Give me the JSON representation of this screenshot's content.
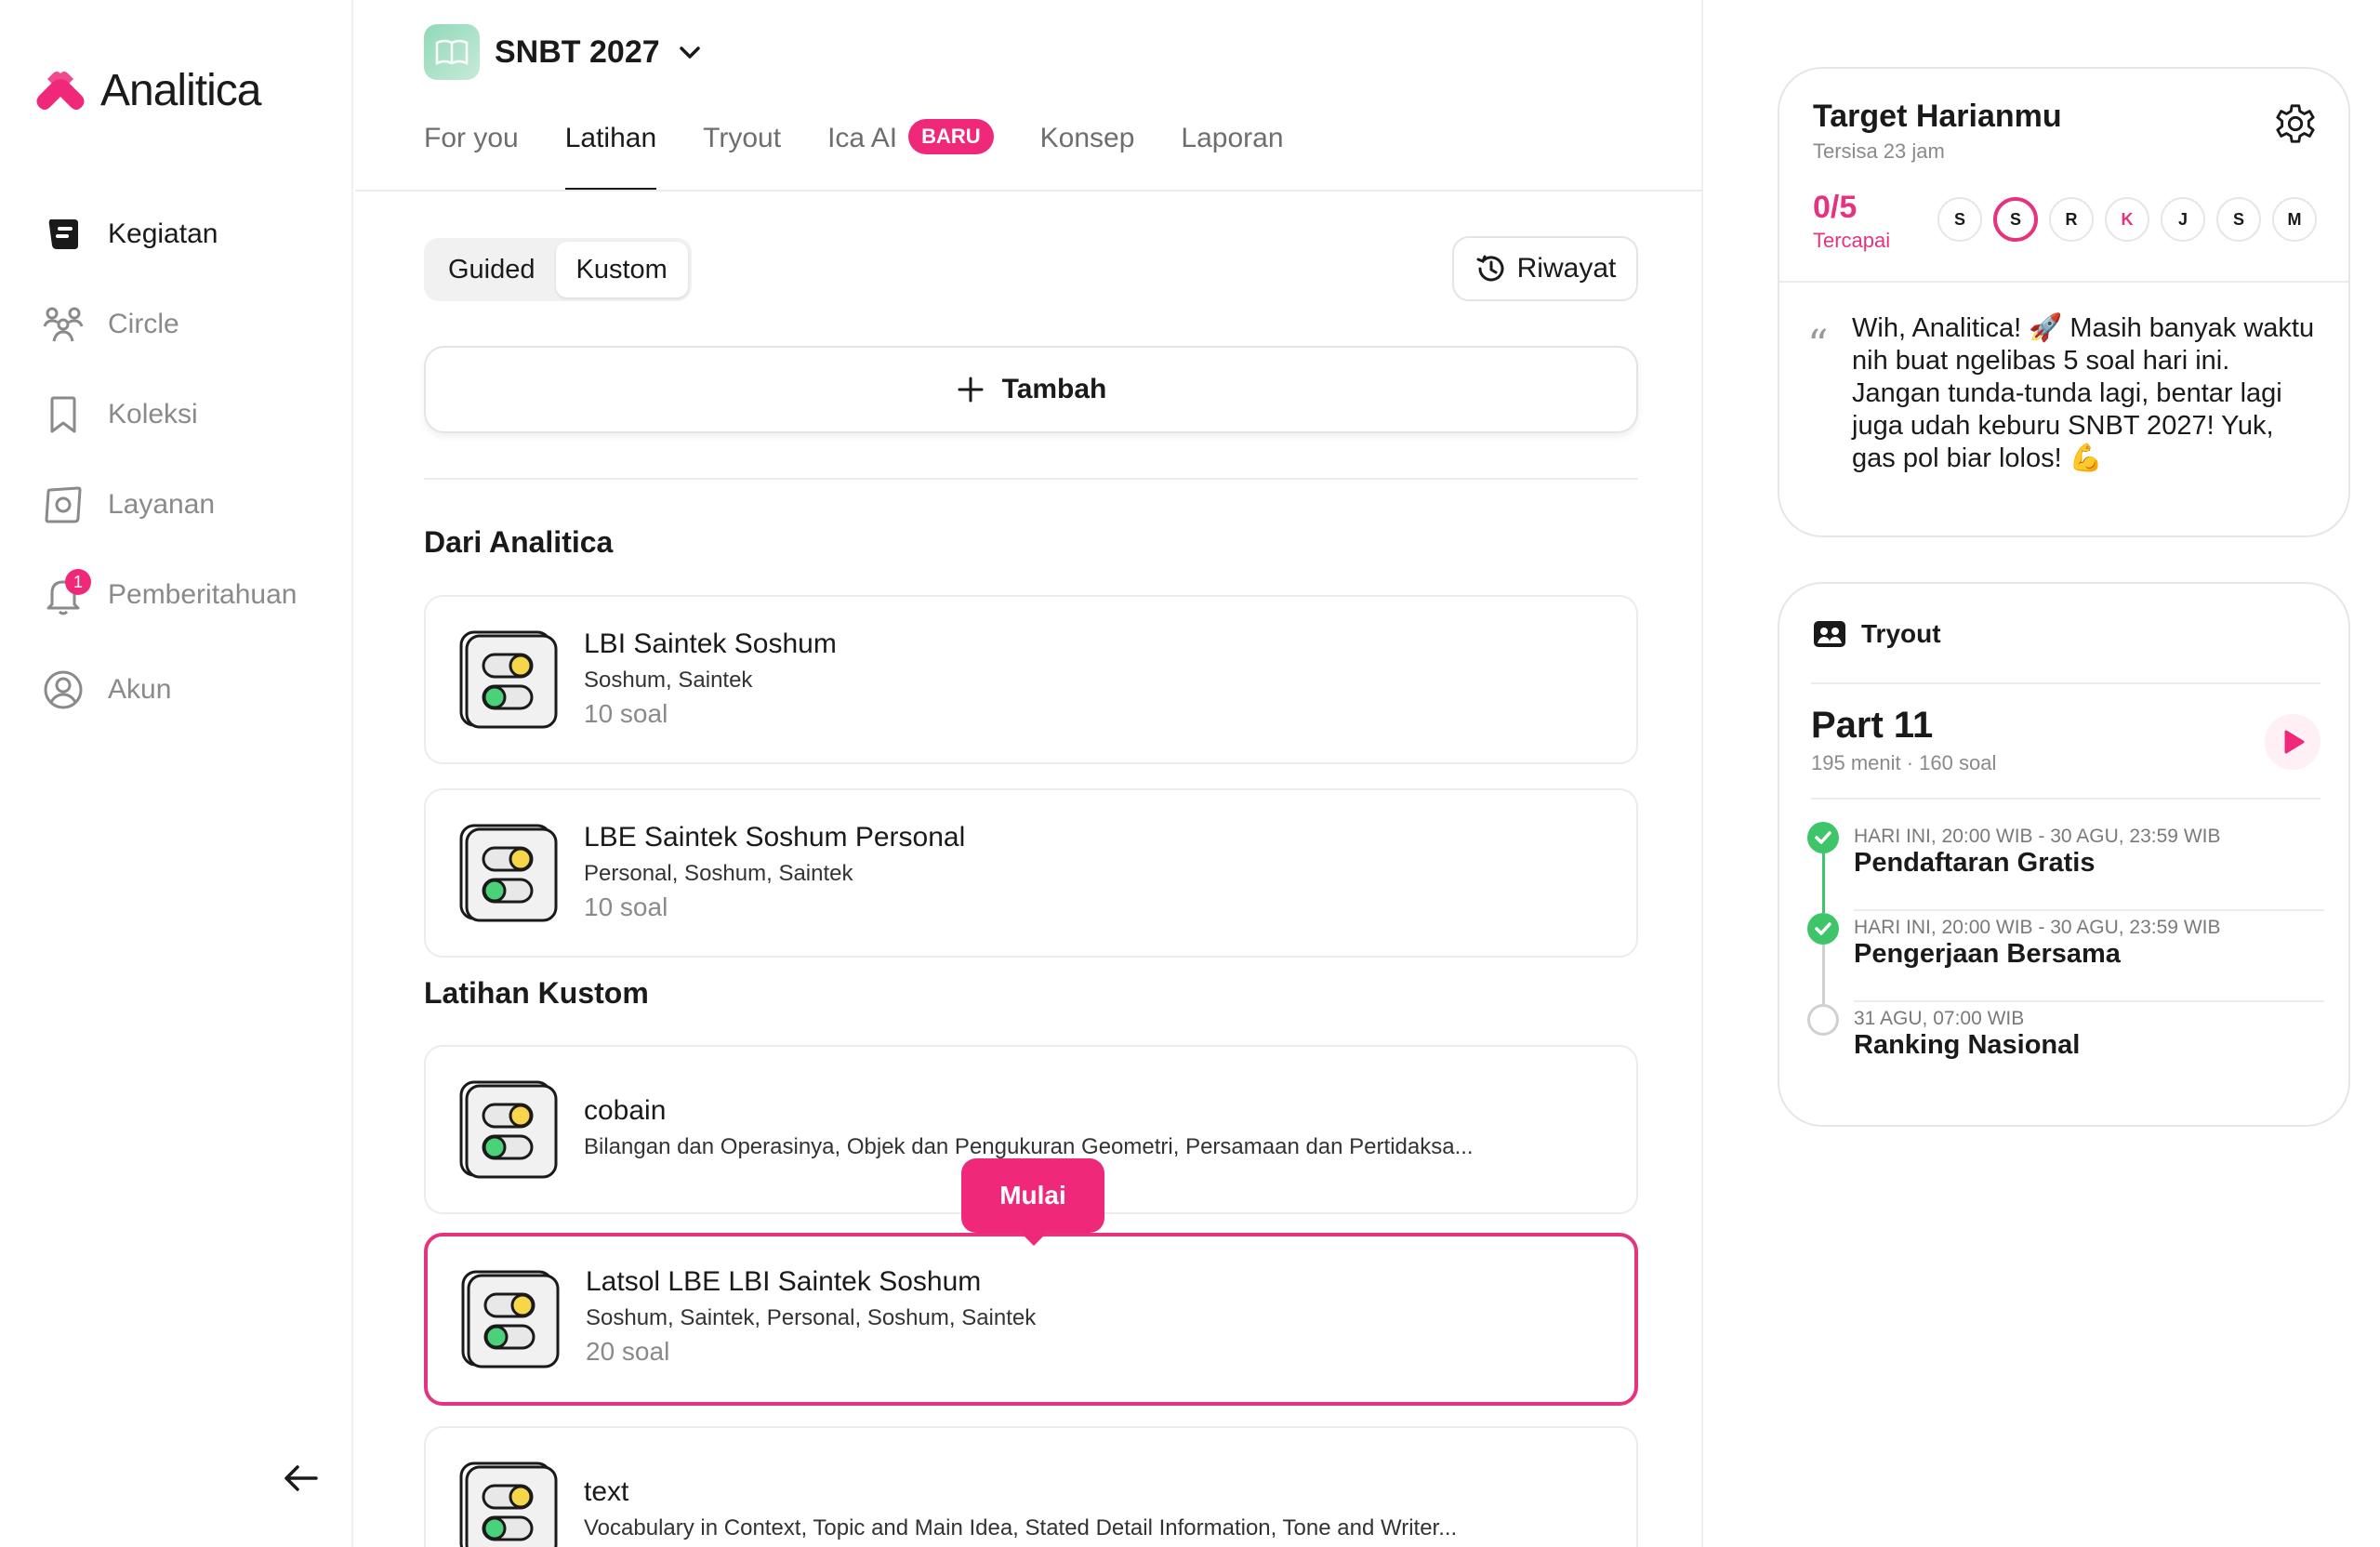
{
  "brand": {
    "name": "Analitica",
    "color": "#f0287a"
  },
  "sidebar": {
    "items": [
      {
        "key": "kegiatan",
        "label": "Kegiatan",
        "icon": "activity-icon",
        "active": true
      },
      {
        "key": "circle",
        "label": "Circle",
        "icon": "people-icon",
        "active": false
      },
      {
        "key": "koleksi",
        "label": "Koleksi",
        "icon": "bookmark-icon",
        "active": false
      },
      {
        "key": "layanan",
        "label": "Layanan",
        "icon": "service-icon",
        "active": false
      },
      {
        "key": "pemberitahuan",
        "label": "Pemberitahuan",
        "icon": "bell-icon",
        "active": false,
        "badge": "1"
      },
      {
        "key": "akun",
        "label": "Akun",
        "icon": "user-icon",
        "active": false
      }
    ]
  },
  "header": {
    "exam": "SNBT 2027",
    "tabs": [
      {
        "label": "For you",
        "active": false
      },
      {
        "label": "Latihan",
        "active": true
      },
      {
        "label": "Tryout",
        "active": false
      },
      {
        "label": "Ica AI",
        "active": false,
        "badge": "BARU"
      },
      {
        "label": "Konsep",
        "active": false
      },
      {
        "label": "Laporan",
        "active": false
      }
    ]
  },
  "toolbar": {
    "segments": [
      {
        "label": "Guided",
        "active": false
      },
      {
        "label": "Kustom",
        "active": true
      }
    ],
    "history_label": "Riwayat",
    "add_label": "Tambah"
  },
  "sections": {
    "dari_analitica": "Dari Analitica",
    "latihan_kustom": "Latihan Kustom"
  },
  "cards_analitica": [
    {
      "title": "LBI Saintek Soshum",
      "tags": "Soshum, Saintek",
      "count": "10 soal"
    },
    {
      "title": "LBE Saintek Soshum Personal",
      "tags": "Personal, Soshum, Saintek",
      "count": "10 soal"
    }
  ],
  "cards_kustom": [
    {
      "title": "cobain",
      "tags": "Bilangan dan Operasinya, Objek dan Pengukuran Geometri, Persamaan dan Pertidaksa...",
      "count": ""
    },
    {
      "title": "Latsol LBE LBI Saintek Soshum",
      "tags": "Soshum, Saintek, Personal, Soshum, Saintek",
      "count": "20 soal",
      "selected": true
    },
    {
      "title": "text",
      "tags": "Vocabulary in Context, Topic and Main Idea, Stated Detail Information, Tone and Writer...",
      "count": ""
    }
  ],
  "tooltip": {
    "label": "Mulai"
  },
  "target": {
    "title": "Target Harianmu",
    "remaining": "Tersisa 23 jam",
    "progress": "0/5",
    "progress_label": "Tercapai",
    "days": [
      "S",
      "S",
      "R",
      "K",
      "J",
      "S",
      "M"
    ],
    "current_day_index": 1,
    "today_index": 3,
    "message": "Wih, Analitica! 🚀 Masih banyak waktu nih buat ngelibas 5 soal hari ini. Jangan tunda-tunda lagi, bentar lagi juga udah keburu SNBT 2027! Yuk, gas pol biar lolos! 💪"
  },
  "tryout": {
    "header": "Tryout",
    "part": "Part 11",
    "meta": "195 menit · 160 soal",
    "timeline": [
      {
        "when": "HARI INI, 20:00 WIB - 30 AGU, 23:59 WIB",
        "what": "Pendaftaran Gratis",
        "done": true
      },
      {
        "when": "HARI INI, 20:00 WIB - 30 AGU, 23:59 WIB",
        "what": "Pengerjaan Bersama",
        "done": true
      },
      {
        "when": "31 AGU, 07:00 WIB",
        "what": "Ranking Nasional",
        "done": false
      }
    ]
  },
  "colors": {
    "accent": "#e5337f",
    "success": "#3ec56a",
    "muted": "#8a8a8a"
  }
}
